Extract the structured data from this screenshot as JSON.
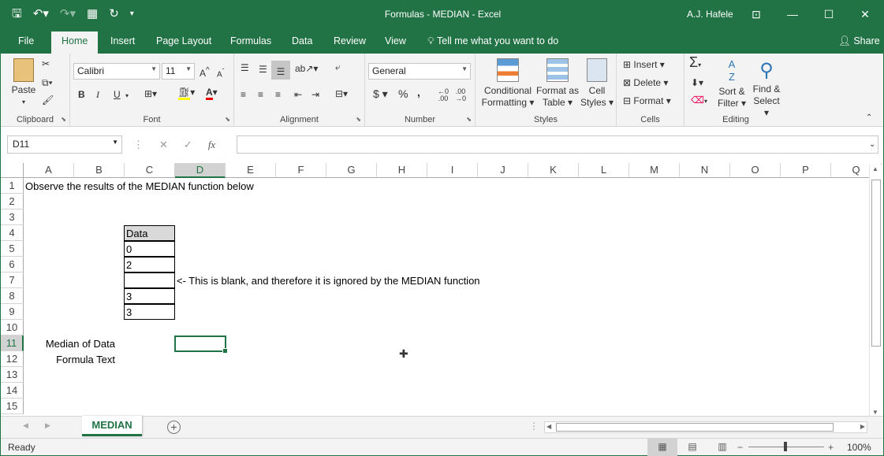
{
  "window": {
    "title": "Formulas - MEDIAN  -  Excel",
    "user": "A.J. Hafele"
  },
  "tabs": [
    "File",
    "Home",
    "Insert",
    "Page Layout",
    "Formulas",
    "Data",
    "Review",
    "View"
  ],
  "tell_me": "Tell me what you want to do",
  "share": "Share",
  "ribbon": {
    "clipboard": {
      "label": "Clipboard",
      "paste": "Paste"
    },
    "font": {
      "label": "Font",
      "name": "Calibri",
      "size": "11",
      "bold": "B",
      "italic": "I",
      "underline": "U"
    },
    "alignment": {
      "label": "Alignment"
    },
    "number": {
      "label": "Number",
      "format": "General",
      "currency": "$",
      "percent": "%",
      "comma": ","
    },
    "styles": {
      "label": "Styles",
      "conditional": "Conditional",
      "conditional2": "Formatting",
      "format_as": "Format as",
      "format_as2": "Table",
      "cell": "Cell",
      "cell2": "Styles"
    },
    "cells": {
      "label": "Cells",
      "insert": "Insert",
      "delete": "Delete",
      "format": "Format"
    },
    "editing": {
      "label": "Editing",
      "sort": "Sort &",
      "sort2": "Filter",
      "find": "Find &",
      "find2": "Select"
    }
  },
  "formula_bar": {
    "name_box": "D11",
    "fx": "fx",
    "formula": ""
  },
  "columns": [
    "A",
    "B",
    "C",
    "D",
    "E",
    "F",
    "G",
    "H",
    "I",
    "J",
    "K",
    "L",
    "M",
    "N",
    "O",
    "P",
    "Q"
  ],
  "rows": [
    "1",
    "2",
    "3",
    "4",
    "5",
    "6",
    "7",
    "8",
    "9",
    "10",
    "11",
    "12",
    "13",
    "14",
    "15"
  ],
  "cells": {
    "a1": "Observe the results of the MEDIAN function below",
    "c4": "Data",
    "c5": "0",
    "c6": "2",
    "c7": "",
    "c8": "3",
    "c9": "3",
    "d7": "<- This is blank, and therefore it is ignored by the MEDIAN function",
    "b11": "Median of Data",
    "b12": "Formula Text"
  },
  "sheet": {
    "name": "MEDIAN"
  },
  "status": {
    "ready": "Ready",
    "zoom": "100%"
  }
}
